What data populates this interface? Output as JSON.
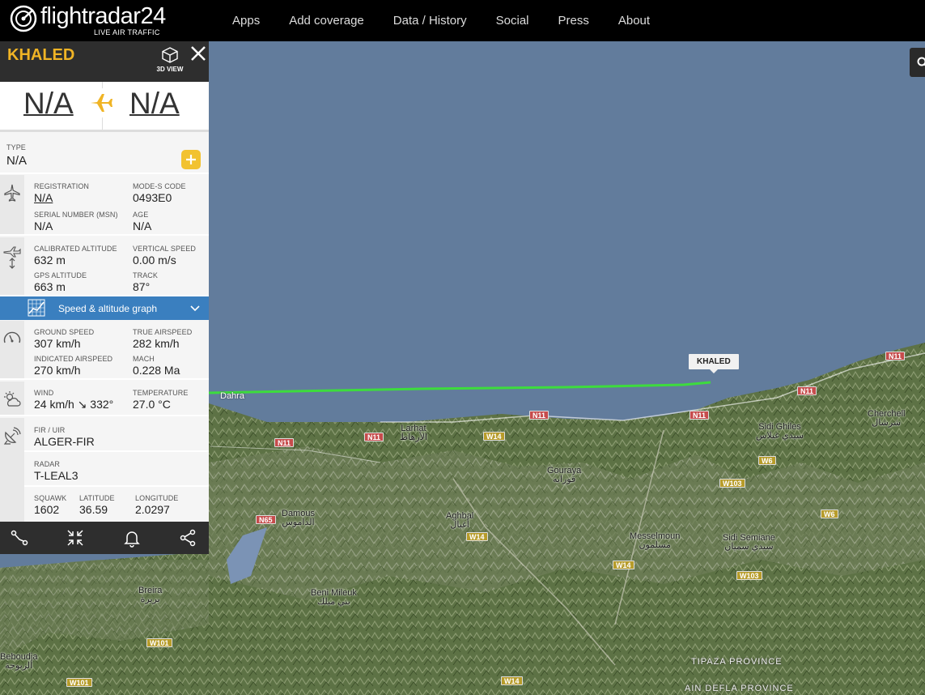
{
  "brand": {
    "logo_text": "flightradar24",
    "tagline": "LIVE AIR TRAFFIC"
  },
  "nav": [
    "Apps",
    "Add coverage",
    "Data / History",
    "Social",
    "Press",
    "About"
  ],
  "colors": {
    "accent": "#f0b425",
    "panel_header": "#2e2e2e",
    "graph_bar": "#3a7fbf",
    "track": "#3ddc3d",
    "plane": "#c1272d",
    "sea": "#627c9c"
  },
  "panel": {
    "callsign": "KHALED",
    "view_3d_label": "3D VIEW",
    "route": {
      "from": "N/A",
      "to": "N/A"
    },
    "type": {
      "label": "TYPE",
      "value": "N/A"
    },
    "aircraft": {
      "registration_label": "REGISTRATION",
      "registration": "N/A",
      "modes_label": "MODE-S CODE",
      "modes": "0493E0",
      "msn_label": "SERIAL NUMBER (MSN)",
      "msn": "N/A",
      "age_label": "AGE",
      "age": "N/A"
    },
    "altitude": {
      "cal_label": "CALIBRATED ALTITUDE",
      "cal": "632 m",
      "vs_label": "VERTICAL SPEED",
      "vs": "0.00 m/s",
      "gps_label": "GPS ALTITUDE",
      "gps": "663 m",
      "track_label": "TRACK",
      "track": "87°"
    },
    "graph_label": "Speed & altitude graph",
    "speed": {
      "gs_label": "GROUND SPEED",
      "gs": "307 km/h",
      "tas_label": "TRUE AIRSPEED",
      "tas": "282 km/h",
      "ias_label": "INDICATED AIRSPEED",
      "ias": "270 km/h",
      "mach_label": "MACH",
      "mach": "0.228 Ma"
    },
    "weather": {
      "wind_label": "WIND",
      "wind": "24 km/h ↘ 332°",
      "temp_label": "TEMPERATURE",
      "temp": "27.0 °C"
    },
    "fir": {
      "label": "FIR / UIR",
      "value": "ALGER-FIR"
    },
    "radar": {
      "label": "RADAR",
      "value": "T-LEAL3"
    },
    "position": {
      "squawk_label": "SQUAWK",
      "squawk": "1602",
      "lat_label": "LATITUDE",
      "lat": "36.59",
      "lon_label": "LONGITUDE",
      "lon": "2.0297"
    }
  },
  "map": {
    "aircraft_label": "KHALED",
    "places": [
      {
        "name": "Dahra",
        "ar": ""
      },
      {
        "name": "Larhat",
        "ar": "الأرهاط"
      },
      {
        "name": "Gouraya",
        "ar": "قورايه"
      },
      {
        "name": "Sidi Ghiles",
        "ar": "سيدي غيلاس"
      },
      {
        "name": "Cherchell",
        "ar": "شرشال"
      },
      {
        "name": "Damous",
        "ar": "الداموس"
      },
      {
        "name": "Aghbal",
        "ar": "أغبال"
      },
      {
        "name": "Messelmoun",
        "ar": "مسلمون"
      },
      {
        "name": "Sidi Semiane",
        "ar": "سيدي سميان"
      },
      {
        "name": "Breira",
        "ar": "بريرة"
      },
      {
        "name": "Beni Mileuk",
        "ar": "بني ميلك"
      },
      {
        "name": "Beboudja",
        "ar": "الزبوجة"
      }
    ],
    "roads": [
      "N11",
      "N11",
      "N11",
      "N11",
      "N11",
      "W14",
      "W14",
      "W14",
      "W14",
      "W6",
      "W6",
      "W103",
      "W103",
      "N65",
      "W101",
      "W101"
    ],
    "provinces": [
      "TIPAZA PROVINCE",
      "AIN DEFLA PROVINCE"
    ]
  }
}
